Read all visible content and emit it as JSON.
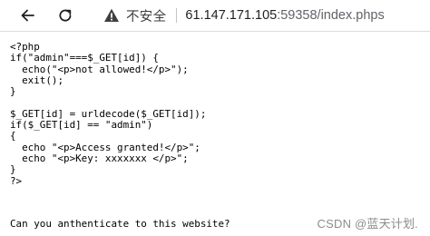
{
  "browser": {
    "security_label": "不安全",
    "url_host": "61.147.171.105",
    "url_rest": ":59358/index.phps",
    "icons": {
      "back": "back-arrow-icon",
      "reload": "reload-icon",
      "warning": "warning-triangle-icon"
    }
  },
  "page": {
    "code_lines": [
      "<?php",
      "if(\"admin\"===$_GET[id]) {",
      "  echo(\"<p>not allowed!</p>\");",
      "  exit();",
      "}",
      "",
      "$_GET[id] = urldecode($_GET[id]);",
      "if($_GET[id] == \"admin\")",
      "{",
      "  echo \"<p>Access granted!</p>\";",
      "  echo \"<p>Key: xxxxxxx </p>\";",
      "}",
      "?>"
    ],
    "question": "Can you anthenticate to this website?"
  },
  "watermark": "CSDN @蓝天计划."
}
